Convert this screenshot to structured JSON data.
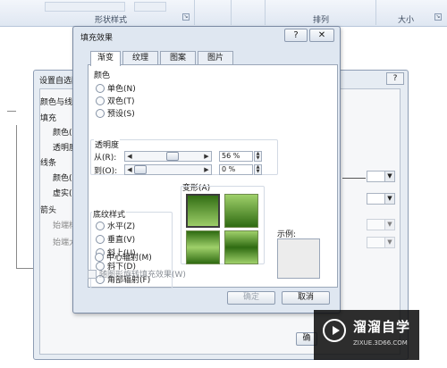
{
  "ribbon": {
    "group_shape_styles": "形状样式",
    "group_arrange": "排列",
    "group_size": "大小",
    "launcher_glyph": "↘"
  },
  "back_dialog": {
    "title": "设置自选图",
    "help_glyph": "?",
    "nav": {
      "colors_lines": "颜色与线",
      "fill": "填充",
      "fill_color": "颜色(",
      "fill_transparency": "透明度",
      "line": "线条",
      "line_color": "颜色(",
      "line_dash": "虚实(",
      "arrows": "箭头",
      "begin_style": "始端样",
      "end_style": "始端大"
    },
    "button_partial": "确"
  },
  "fill_dialog": {
    "title": "填充效果",
    "help_glyph": "?",
    "close_glyph": "✕",
    "tabs": [
      {
        "label": "渐变",
        "active": true
      },
      {
        "label": "纹理",
        "active": false
      },
      {
        "label": "图案",
        "active": false
      },
      {
        "label": "图片",
        "active": false
      }
    ],
    "colors": {
      "label": "颜色",
      "options": [
        "单色(N)",
        "双色(T)",
        "预设(S)"
      ]
    },
    "transparency": {
      "label": "透明度",
      "from_label": "从(R):",
      "to_label": "到(O):",
      "from_value": "56 %",
      "to_value": "0 %",
      "from_level": 0.56,
      "to_level": 0.0
    },
    "shading_styles": {
      "label": "底纹样式",
      "options": [
        "水平(Z)",
        "垂直(V)",
        "斜上(U)",
        "斜下(D)",
        "角部辐射(F)",
        "中心辐射(M)"
      ]
    },
    "variants_label": "变形(A)",
    "sample_label": "示例:",
    "rotate_checkbox": "随图形旋转填充效果(W)",
    "ok_button": "确定",
    "cancel_button": "取消"
  },
  "icons": {
    "arrow_left": "◀",
    "arrow_right": "▶",
    "spin_up": "▲",
    "spin_down": "▼",
    "dropdown": "▼"
  },
  "watermark": {
    "title": "溜溜自学",
    "url": "ZIXUE.3D66.COM"
  },
  "colors": {
    "gradient_dark": "#2f6b12",
    "gradient_light": "#9fd06a",
    "dialog_bg": "#dfe7f1"
  }
}
